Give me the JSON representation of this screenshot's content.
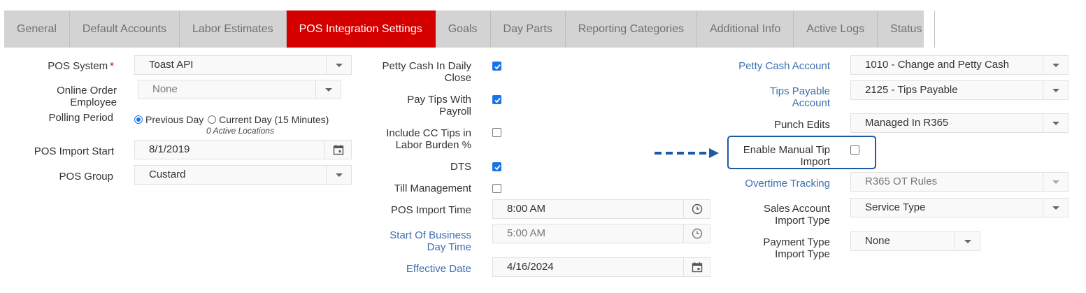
{
  "tabs": [
    {
      "label": "General"
    },
    {
      "label": "Default Accounts"
    },
    {
      "label": "Labor Estimates"
    },
    {
      "label": "POS Integration Settings",
      "active": true
    },
    {
      "label": "Goals"
    },
    {
      "label": "Day Parts"
    },
    {
      "label": "Reporting Categories"
    },
    {
      "label": "Additional Info"
    },
    {
      "label": "Active Logs"
    },
    {
      "label": "Status"
    }
  ],
  "left": {
    "pos_system": {
      "label": "POS System",
      "required": "*",
      "value": "Toast API"
    },
    "online_order_employee": {
      "label_line1": "Online Order",
      "label_line2": "Employee",
      "value": "None"
    },
    "polling_period": {
      "label": "Polling Period",
      "option1": "Previous Day",
      "option2": "Current Day (15 Minutes)",
      "selected": "Previous Day",
      "note": "0 Active Locations"
    },
    "pos_import_start": {
      "label": "POS Import Start",
      "value": "8/1/2019"
    },
    "pos_group": {
      "label": "POS Group",
      "value": "Custard"
    }
  },
  "middle": {
    "petty_cash_daily_close": {
      "label_line1": "Petty Cash In Daily",
      "label_line2": "Close",
      "checked": true
    },
    "pay_tips_with_payroll": {
      "label_line1": "Pay Tips With",
      "label_line2": "Payroll",
      "checked": true
    },
    "include_cc_tips": {
      "label_line1": "Include CC Tips in",
      "label_line2": "Labor Burden %",
      "checked": false
    },
    "dts": {
      "label": "DTS",
      "checked": true
    },
    "till_management": {
      "label": "Till Management",
      "checked": false
    },
    "pos_import_time": {
      "label": "POS Import Time",
      "value": "8:00 AM"
    },
    "start_of_business_day": {
      "label_line1": "Start Of Business",
      "label_line2": "Day Time",
      "value": "5:00 AM"
    },
    "effective_date": {
      "label": "Effective Date",
      "value": "4/16/2024"
    }
  },
  "right": {
    "petty_cash_account": {
      "label": "Petty Cash Account",
      "value": "1010 - Change and Petty Cash"
    },
    "tips_payable_account": {
      "label_line1": "Tips Payable",
      "label_line2": "Account",
      "value": "2125 - Tips Payable"
    },
    "punch_edits": {
      "label": "Punch Edits",
      "value": "Managed In R365"
    },
    "enable_manual_tip_import": {
      "label_line1": "Enable Manual Tip",
      "label_line2": "Import",
      "checked": false
    },
    "overtime_tracking": {
      "label": "Overtime Tracking",
      "value": "R365 OT Rules"
    },
    "sales_account_import_type": {
      "label_line1": "Sales Account",
      "label_line2": "Import Type",
      "value": "Service Type"
    },
    "payment_type_import_type": {
      "label_line1": "Payment Type",
      "label_line2": "Import Type",
      "value": "None"
    }
  },
  "colors": {
    "active_tab": "#d40000",
    "tab_bar": "#d3d3d3",
    "link_label": "#3d6fb0",
    "checkbox": "#1a73e8",
    "annotation": "#1f5aa6"
  }
}
